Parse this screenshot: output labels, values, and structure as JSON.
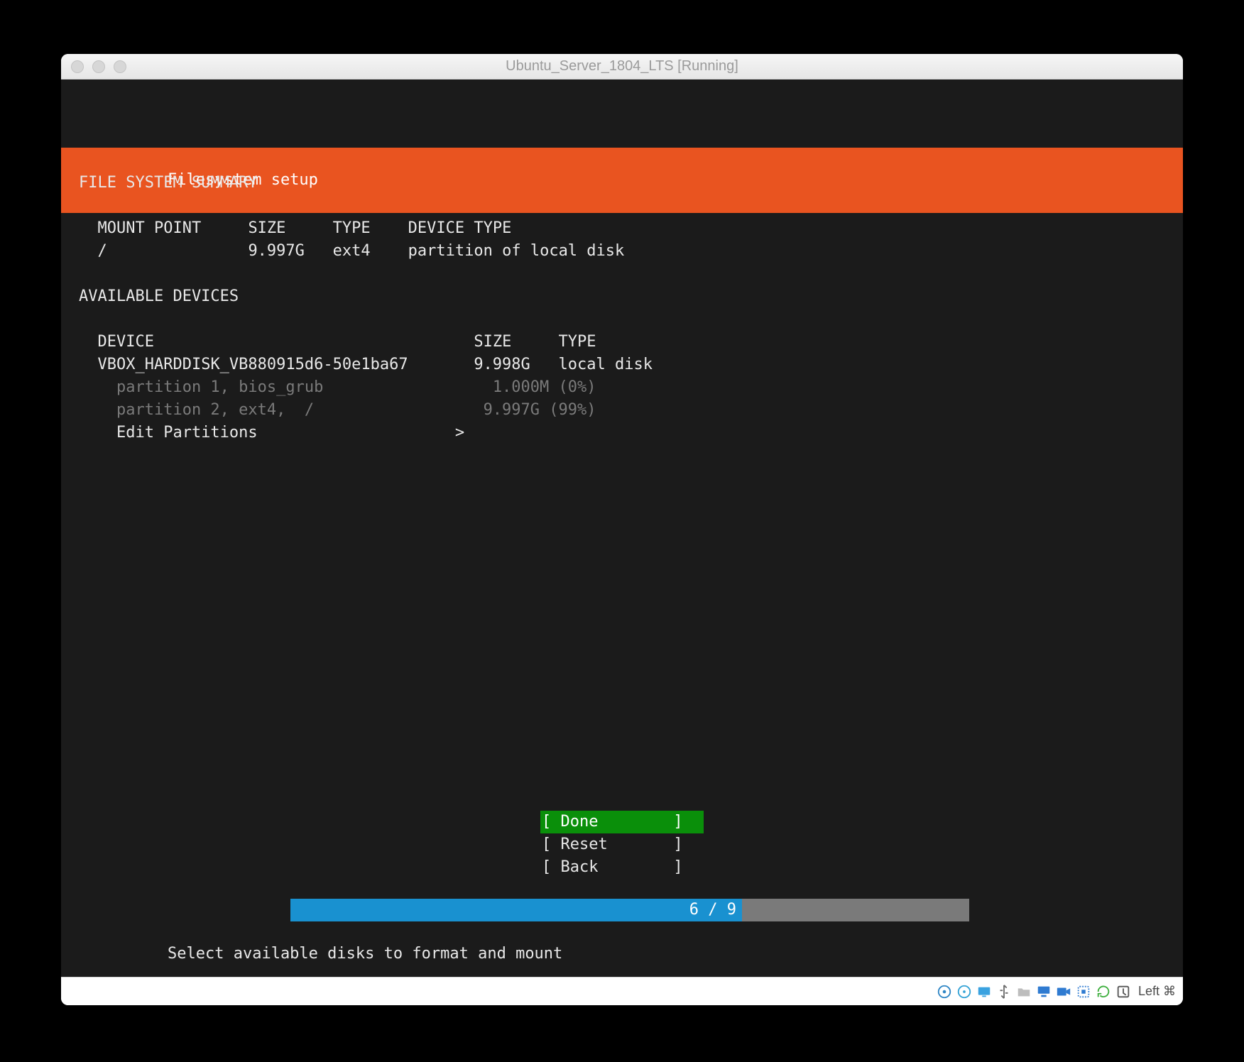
{
  "window": {
    "title": "Ubuntu_Server_1804_LTS [Running]"
  },
  "header": {
    "title": "Filesystem setup"
  },
  "summary": {
    "heading": "FILE SYSTEM SUMMARY",
    "cols": {
      "mount": "MOUNT POINT",
      "size": "SIZE",
      "type": "TYPE",
      "dtype": "DEVICE TYPE"
    },
    "rows": [
      {
        "mount": "/",
        "size": "9.997G",
        "type": "ext4",
        "dtype": "partition of local disk"
      }
    ]
  },
  "devices": {
    "heading": "AVAILABLE DEVICES",
    "cols": {
      "device": "DEVICE",
      "size": "SIZE",
      "type": "TYPE"
    },
    "disk": {
      "name": "VBOX_HARDDISK_VB880915d6-50e1ba67",
      "size": "9.998G",
      "type": "local disk"
    },
    "partitions": [
      {
        "label": "partition 1, bios_grub",
        "size": "1.000M",
        "pct": "(0%)"
      },
      {
        "label": "partition 2, ext4,  /",
        "size": "9.997G",
        "pct": "(99%)"
      }
    ],
    "edit_label": "Edit Partitions",
    "edit_arrow": ">"
  },
  "buttons": {
    "done": "[ Done        ]",
    "reset": "[ Reset       ]",
    "back": "[ Back        ]"
  },
  "progress": {
    "label": "6 / 9",
    "current": 6,
    "total": 9
  },
  "hint": "Select available disks to format and mount",
  "statusbar": {
    "icons": [
      "harddisk-icon",
      "optical-disc-icon",
      "display-icon",
      "usb-icon",
      "shared-folder-icon",
      "network-icon",
      "video-capture-icon",
      "audio-icon",
      "refresh-icon",
      "record-icon"
    ],
    "hostkey": "Left ⌘"
  }
}
